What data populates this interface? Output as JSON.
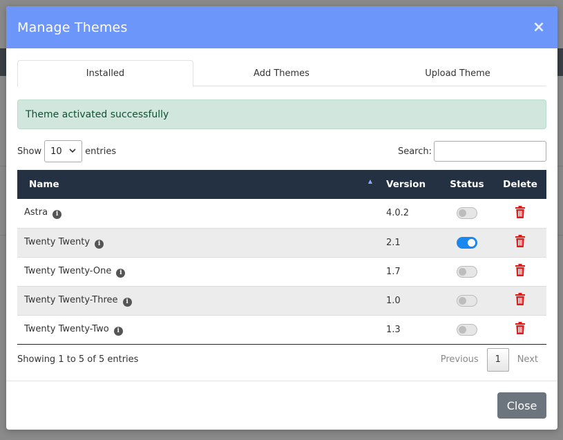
{
  "modal": {
    "title": "Manage Themes",
    "close_icon": "×",
    "close_label": "Close"
  },
  "tabs": [
    {
      "label": "Installed",
      "active": true
    },
    {
      "label": "Add Themes",
      "active": false
    },
    {
      "label": "Upload Theme",
      "active": false
    }
  ],
  "alert": {
    "text": "Theme activated successfully",
    "color": "#d1e7dd"
  },
  "controls": {
    "show_label": "Show",
    "entries_label": "entries",
    "page_size": "10",
    "search_label": "Search:",
    "search_value": ""
  },
  "table": {
    "columns": [
      "Name",
      "Version",
      "Status",
      "Delete"
    ],
    "rows": [
      {
        "name": "Astra",
        "version": "4.0.2",
        "active": false
      },
      {
        "name": "Twenty Twenty",
        "version": "2.1",
        "active": true
      },
      {
        "name": "Twenty Twenty-One",
        "version": "1.7",
        "active": false
      },
      {
        "name": "Twenty Twenty-Three",
        "version": "1.0",
        "active": false
      },
      {
        "name": "Twenty Twenty-Two",
        "version": "1.3",
        "active": false
      }
    ]
  },
  "pagination": {
    "info": "Showing 1 to 5 of 5 entries",
    "previous": "Previous",
    "current": "1",
    "next": "Next"
  },
  "colors": {
    "header": "#6c96fa",
    "table_head": "#243142",
    "toggle_on": "#1b87f0",
    "delete": "#e01919"
  },
  "icons": {
    "info": "info-icon",
    "delete": "trash-icon",
    "sort": "sort-asc-icon"
  }
}
